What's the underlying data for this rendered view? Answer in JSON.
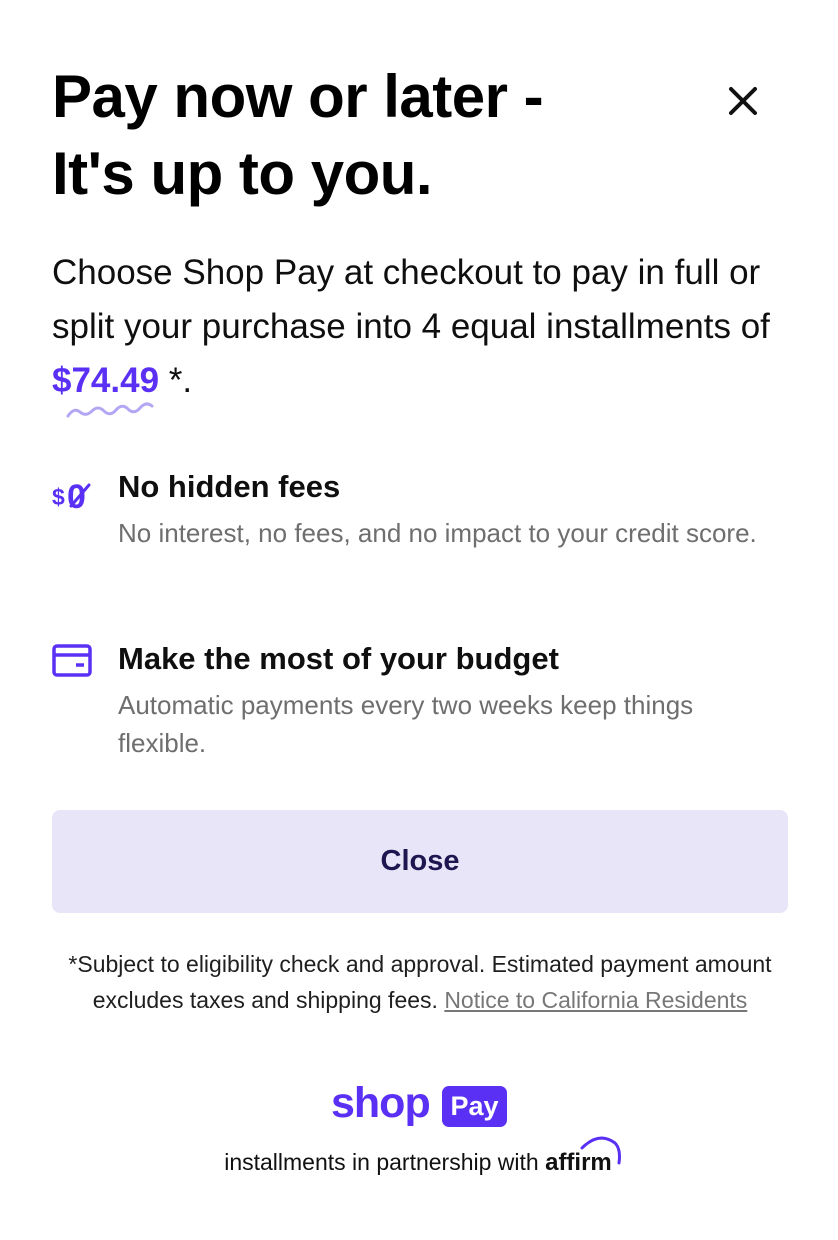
{
  "header": {
    "title_line1": "Pay now or later -",
    "title_line2": "It's up to you."
  },
  "intro": {
    "text_before": "Choose Shop Pay at checkout to pay in full or split your purchase into 4 equal installments of ",
    "amount": "$74.49",
    "text_after": " *."
  },
  "features": [
    {
      "icon": "zero-dollar-icon",
      "icon_text_dollar": "$",
      "icon_text_zero": "0",
      "title": "No hidden fees",
      "description": "No interest, no fees, and no impact to your credit score."
    },
    {
      "icon": "credit-card-icon",
      "title": "Make the most of your budget",
      "description": "Automatic payments every two weeks keep things flexible."
    }
  ],
  "actions": {
    "close_label": "Close"
  },
  "disclaimer": {
    "text": "*Subject to eligibility check and approval. Estimated payment amount excludes taxes and shipping fees. ",
    "link_label": "Notice to California Residents"
  },
  "brand": {
    "shop": "shop",
    "pay": "Pay"
  },
  "partnership": {
    "text": "installments in partnership with ",
    "partner": "affirm"
  },
  "colors": {
    "accent": "#5a31f4",
    "button_bg": "#e8e5f8",
    "button_text": "#1d1650",
    "muted_text": "#6e6e6e"
  }
}
